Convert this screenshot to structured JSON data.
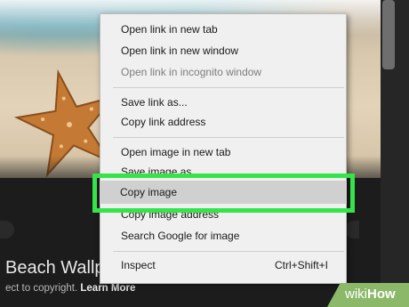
{
  "context_menu": {
    "items": [
      {
        "label": "Open link in new tab",
        "disabled": false
      },
      {
        "label": "Open link in new window",
        "disabled": false
      },
      {
        "label": "Open link in incognito window",
        "disabled": true
      },
      {
        "label": "Save link as...",
        "disabled": false
      },
      {
        "label": "Copy link address",
        "disabled": false
      },
      {
        "label": "Open image in new tab",
        "disabled": false
      },
      {
        "label": "Save image as...",
        "disabled": false
      },
      {
        "label": "Copy image",
        "disabled": false,
        "highlighted": true
      },
      {
        "label": "Copy image address",
        "disabled": false
      },
      {
        "label": "Search Google for image",
        "disabled": false
      },
      {
        "label": "Inspect",
        "shortcut": "Ctrl+Shift+I",
        "disabled": false
      }
    ]
  },
  "page": {
    "result_title": "Beach Wallp",
    "copyright_text": "ect to copyright.",
    "learn_more": "Learn More"
  },
  "watermark": {
    "wiki": "wiki",
    "how": "How"
  },
  "colors": {
    "highlight_border": "#35e44a",
    "menu_bg": "#f0f0f0",
    "disabled_text": "#7d7d7d"
  }
}
